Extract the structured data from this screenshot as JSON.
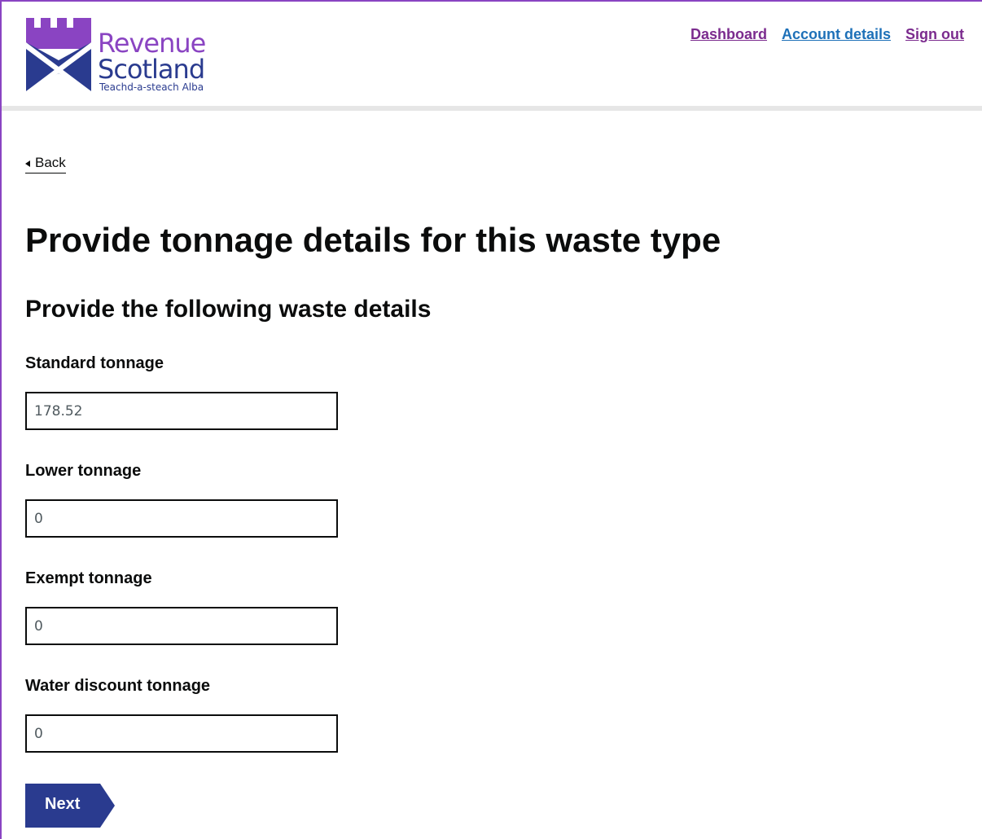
{
  "logo": {
    "line1": "Revenue",
    "line2": "Scotland",
    "tagline": "Teachd-a-steach Alba"
  },
  "nav": {
    "dashboard": "Dashboard",
    "account_details": "Account details",
    "sign_out": "Sign out"
  },
  "back_link": "Back",
  "page_title": "Provide tonnage details for this waste type",
  "section_title": "Provide the following waste details",
  "fields": [
    {
      "label": "Standard tonnage",
      "value": "178.52"
    },
    {
      "label": "Lower tonnage",
      "value": "0"
    },
    {
      "label": "Exempt tonnage",
      "value": "0"
    },
    {
      "label": "Water discount tonnage",
      "value": "0"
    }
  ],
  "next_button": "Next",
  "colors": {
    "brand_purple": "#8a44c2",
    "brand_navy": "#2a3b8f",
    "link_blue": "#1d70b8",
    "visited_purple": "#7b2b8e"
  }
}
